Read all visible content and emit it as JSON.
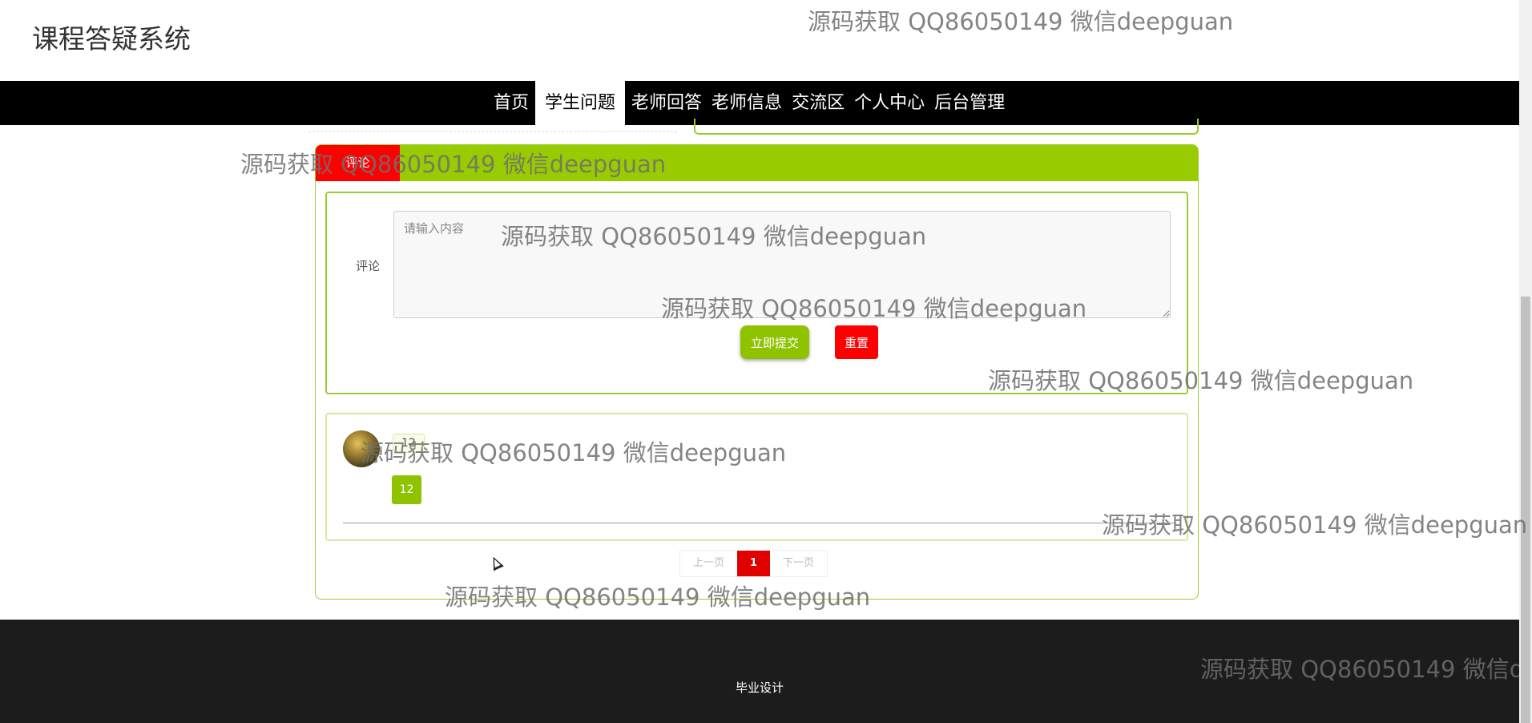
{
  "header": {
    "title": "课程答疑系统"
  },
  "nav": {
    "items": [
      {
        "label": "首页",
        "active": false
      },
      {
        "label": "学生问题",
        "active": true
      },
      {
        "label": "老师回答",
        "active": false
      },
      {
        "label": "老师信息",
        "active": false
      },
      {
        "label": "交流区",
        "active": false
      },
      {
        "label": "个人中心",
        "active": false
      },
      {
        "label": "后台管理",
        "active": false
      }
    ]
  },
  "comment_panel": {
    "tab_label": "评论",
    "form": {
      "label": "评论",
      "textarea_placeholder": "请输入内容",
      "submit_label": "立即提交",
      "reset_label": "重置"
    },
    "comments": [
      {
        "username": "12",
        "content": "12"
      }
    ],
    "pagination": {
      "prev_label": "上一页",
      "current_page": "1",
      "next_label": "下一页"
    }
  },
  "footer": {
    "text": "毕业设计"
  },
  "watermark": {
    "text": "源码获取 QQ86050149 微信deepguan"
  },
  "colors": {
    "accent_green": "#99cc00",
    "accent_red": "#ff0000",
    "navbar": "#000000",
    "footer": "#1c1c1c"
  }
}
